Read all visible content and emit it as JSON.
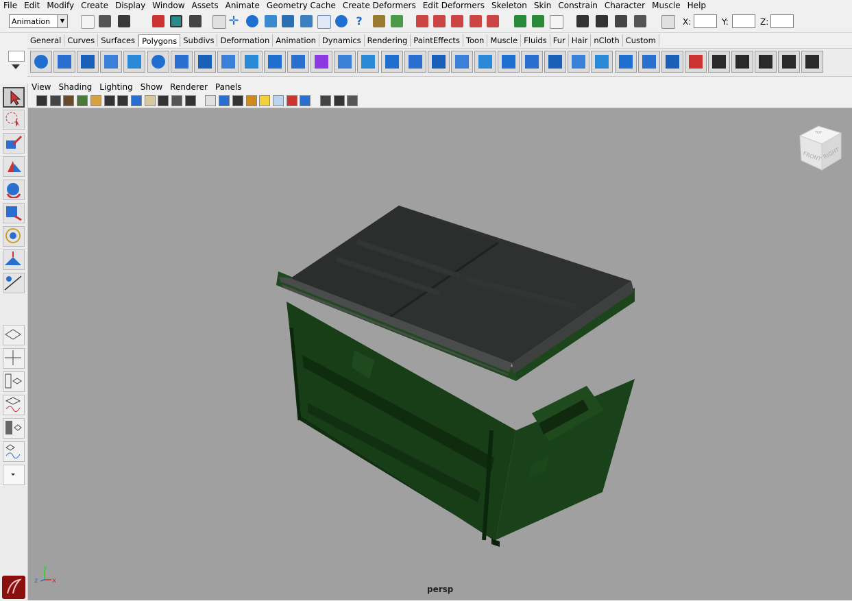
{
  "menubar": {
    "items": [
      "File",
      "Edit",
      "Modify",
      "Create",
      "Display",
      "Window",
      "Assets",
      "Animate",
      "Geometry Cache",
      "Create Deformers",
      "Edit Deformers",
      "Skeleton",
      "Skin",
      "Constrain",
      "Character",
      "Muscle",
      "Help"
    ]
  },
  "status_line": {
    "mode_value": "Animation",
    "x_label": "X:",
    "y_label": "Y:",
    "z_label": "Z:",
    "x_value": "",
    "y_value": "",
    "z_value": ""
  },
  "shelf": {
    "tabs": [
      "General",
      "Curves",
      "Surfaces",
      "Polygons",
      "Subdivs",
      "Deformation",
      "Animation",
      "Dynamics",
      "Rendering",
      "PaintEffects",
      "Toon",
      "Muscle",
      "Fluids",
      "Fur",
      "Hair",
      "nCloth",
      "Custom"
    ],
    "active_tab": "Polygons"
  },
  "viewport": {
    "menu": [
      "View",
      "Shading",
      "Lighting",
      "Show",
      "Renderer",
      "Panels"
    ],
    "camera_label": "persp",
    "viewcube": {
      "top": "TOP",
      "front": "FRONT",
      "right": "RIGHT"
    },
    "axis": {
      "y": "y",
      "z": "z",
      "x": "x"
    }
  },
  "colors": {
    "viewport_bg": "#a0a0a0",
    "dumpster_body": "#173c17",
    "dumpster_lid": "#2f3130",
    "accent_blue": "#1f6fd0"
  },
  "icons": {
    "shelf": [
      "poly-sphere-icon",
      "poly-cube-icon",
      "poly-cylinder-icon",
      "poly-cone-icon",
      "poly-plane-icon",
      "poly-torus-icon",
      "poly-prism-icon",
      "poly-pipe-icon",
      "poly-helix-icon",
      "combine-icon",
      "separate-icon",
      "extract-icon",
      "booleans-icon",
      "smooth-icon",
      "average-vertices-icon",
      "mirror-icon",
      "extrude-icon",
      "bridge-icon",
      "append-polygon-icon",
      "split-polygon-icon",
      "insert-edge-loop-icon",
      "offset-edge-loop-icon",
      "poke-icon",
      "wedge-icon",
      "chamfer-icon",
      "bevel-icon",
      "merge-icon",
      "collapse-icon",
      "sculpt-icon",
      "uv-planar-icon",
      "uv-cylindrical-icon",
      "uv-spherical-icon",
      "uv-auto-icon",
      "uv-editor-icon"
    ],
    "toolbox": [
      "select-tool-icon",
      "lasso-tool-icon",
      "paint-select-icon",
      "move-tool-icon",
      "rotate-tool-icon",
      "scale-tool-icon",
      "universal-manip-icon",
      "soft-mod-icon",
      "show-manip-icon"
    ],
    "layouts": [
      "single-perspective-layout-icon",
      "four-view-layout-icon",
      "persp-outliner-layout-icon",
      "persp-graph-layout-icon",
      "hypershade-layout-icon",
      "graph-editor-layout-icon",
      "expand-layouts-icon"
    ]
  }
}
